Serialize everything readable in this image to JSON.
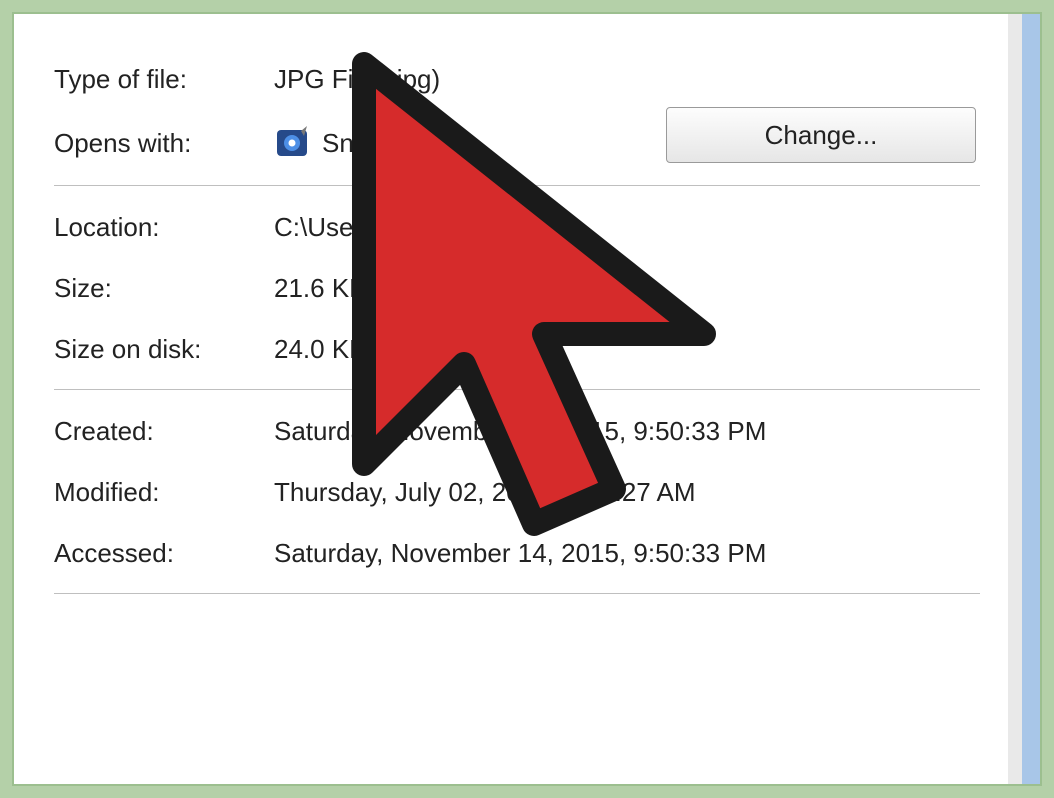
{
  "file_type": {
    "label": "Type of file:",
    "value": "JPG File (.jpg)"
  },
  "opens_with": {
    "label": "Opens with:",
    "app": "Snagit",
    "change_button": "Change..."
  },
  "location": {
    "label": "Location:",
    "value": "C:\\Users\\Us"
  },
  "size": {
    "label": "Size:",
    "value": "21.6 KB (22"
  },
  "size_on_disk": {
    "label": "Size on disk:",
    "value": "24.0 KB (24        byte"
  },
  "created": {
    "label": "Created:",
    "value": "Saturday, November 14, 2015, 9:50:33 PM"
  },
  "modified": {
    "label": "Modified:",
    "value": "Thursday, July 02, 2015, 3:17:27 AM"
  },
  "accessed": {
    "label": "Accessed:",
    "value": "Saturday, November 14, 2015, 9:50:33 PM"
  }
}
